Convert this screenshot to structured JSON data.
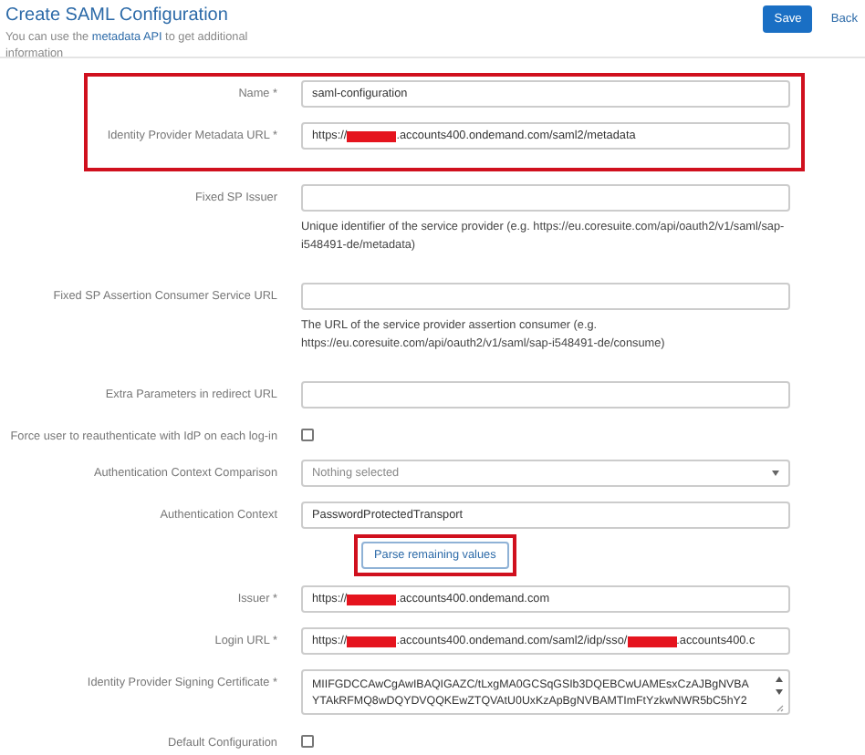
{
  "header": {
    "title": "Create SAML Configuration",
    "subtitle_before": "You can use the",
    "subtitle_link": "metadata API",
    "subtitle_after": "to get additional information",
    "save_button": "Save",
    "back_link": "Back"
  },
  "groups": [
    {
      "highlighted": true,
      "rows": [
        {
          "kind": "text",
          "label": "Name *",
          "value": [
            {
              "kind": "text",
              "text": "saml-configuration"
            }
          ]
        },
        {
          "kind": "text",
          "label": "Identity Provider Metadata URL *",
          "value": [
            {
              "kind": "text",
              "text": "https://"
            },
            {
              "kind": "redacted"
            },
            {
              "kind": "text",
              "text": ".accounts400.ondemand.com/saml2/metadata"
            }
          ]
        }
      ]
    },
    {
      "highlighted": false,
      "rows": [
        {
          "kind": "text",
          "label": "Fixed SP Issuer",
          "help": "Unique identifier of the service provider (e.g. https://eu.coresuite.com/api/oauth2/v1/saml/sap-i548491-de/metadata)"
        },
        {
          "kind": "text",
          "label": "Fixed SP Assertion Consumer Service URL",
          "help": "The URL of the service provider assertion consumer (e.g. https://eu.coresuite.com/api/oauth2/v1/saml/sap-i548491-de/consume)"
        },
        {
          "kind": "text",
          "label": "Extra Parameters in redirect URL"
        },
        {
          "kind": "checkbox",
          "label": "Force user to reauthenticate with IdP on each log-in",
          "checked": false
        },
        {
          "kind": "select",
          "label": "Authentication Context Comparison",
          "placeholder": "Nothing selected"
        },
        {
          "kind": "text",
          "label": "Authentication Context",
          "value": [
            {
              "kind": "text",
              "text": "PasswordProtectedTransport"
            }
          ]
        },
        {
          "kind": "button",
          "text": "Parse remaining values",
          "highlighted": true
        },
        {
          "kind": "text",
          "label": "Issuer *",
          "value": [
            {
              "kind": "text",
              "text": "https://"
            },
            {
              "kind": "redacted"
            },
            {
              "kind": "text",
              "text": ".accounts400.ondemand.com"
            }
          ]
        },
        {
          "kind": "text",
          "label": "Login URL *",
          "value": [
            {
              "kind": "text",
              "text": "https://"
            },
            {
              "kind": "redacted"
            },
            {
              "kind": "text",
              "text": ".accounts400.ondemand.com/saml2/idp/sso/"
            },
            {
              "kind": "redacted"
            },
            {
              "kind": "text",
              "text": ".accounts400.c"
            }
          ]
        },
        {
          "kind": "textarea",
          "label": "Identity Provider Signing Certificate *",
          "lines": [
            "MIIFGDCCAwCgAwIBAQIGAZC/tLxgMA0GCSqGSIb3DQEBCwUAMEsxCzAJBgNVBA",
            "YTAkRFMQ8wDQYDVQQKEwZTQVAtU0UxKzApBgNVBAMTImFtYzkwNWR5bC5hY2"
          ]
        },
        {
          "kind": "checkbox",
          "label": "Default Configuration",
          "checked": false
        }
      ]
    }
  ]
}
